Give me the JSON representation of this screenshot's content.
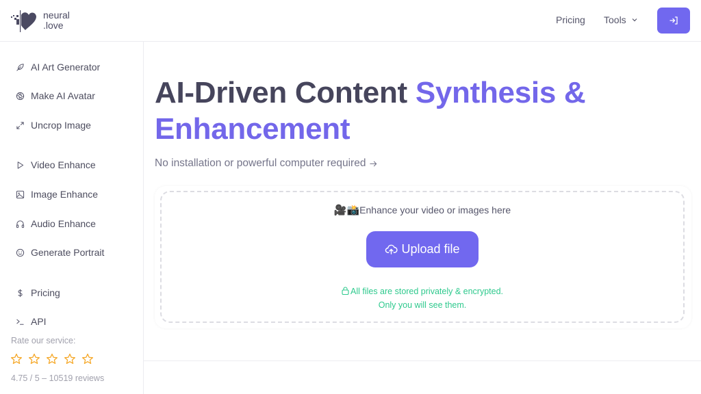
{
  "header": {
    "logo_line1": "neural",
    "logo_line2": ".love",
    "nav": [
      {
        "label": "Pricing"
      },
      {
        "label": "Tools"
      }
    ],
    "login_icon": "login-arrow-icon"
  },
  "sidebar": {
    "items": [
      {
        "label": "AI Art Generator",
        "icon": "feather-icon"
      },
      {
        "label": "Make AI Avatar",
        "icon": "aperture-icon"
      },
      {
        "label": "Uncrop Image",
        "icon": "expand-icon"
      },
      {
        "label": "Video Enhance",
        "icon": "play-icon"
      },
      {
        "label": "Image Enhance",
        "icon": "image-icon"
      },
      {
        "label": "Audio Enhance",
        "icon": "headphones-icon"
      },
      {
        "label": "Generate Portrait",
        "icon": "smile-icon"
      },
      {
        "label": "Pricing",
        "icon": "dollar-icon"
      },
      {
        "label": "API",
        "icon": "terminal-icon"
      }
    ],
    "rating": {
      "label": "Rate our service:",
      "stars_total": 5,
      "summary": "4.75 / 5 – 10519 reviews"
    }
  },
  "hero": {
    "title_plain": "AI-Driven Content ",
    "title_accent": "Synthesis & Enhancement",
    "subtitle": "No installation or powerful computer required"
  },
  "upload": {
    "emoji": "🎥📸",
    "prompt": "Enhance your video or images here",
    "button_label": "Upload file",
    "privacy_line1": "All files are stored privately & encrypted.",
    "privacy_line2": "Only you will see them."
  },
  "colors": {
    "accent": "#7168ef",
    "title_text": "#46455c",
    "success": "#2ec98d",
    "star": "#f5a623"
  }
}
